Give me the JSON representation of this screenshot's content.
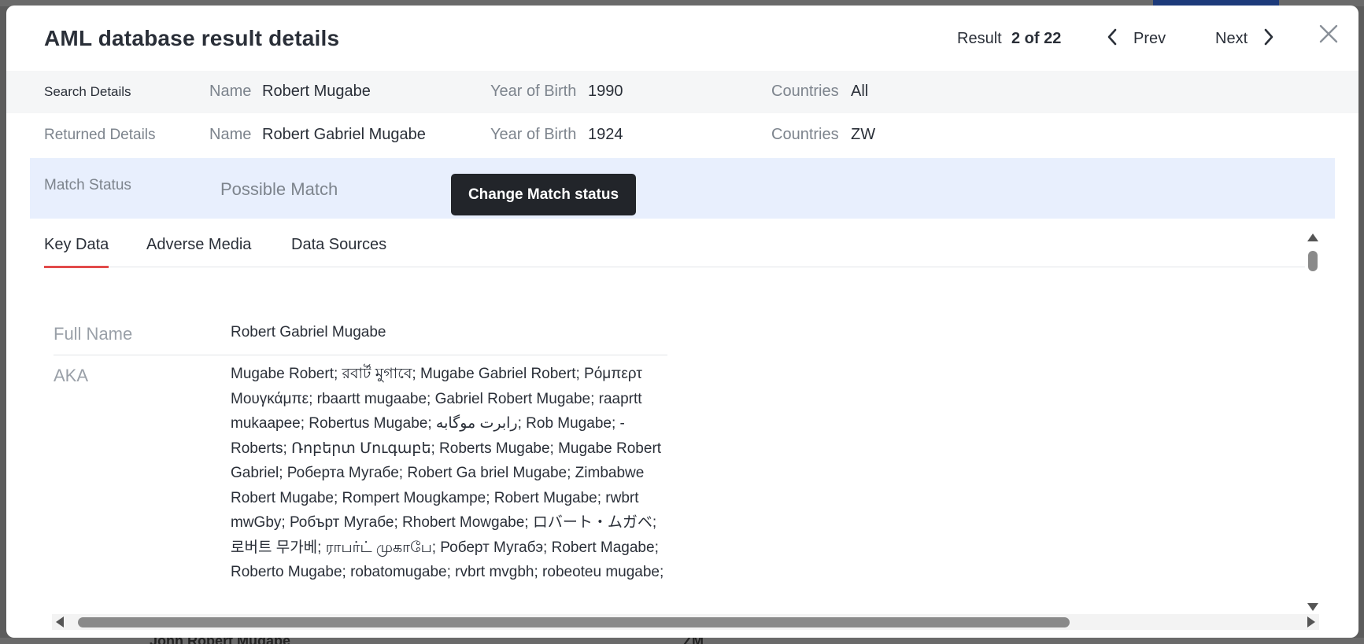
{
  "modal": {
    "title": "AML database result details",
    "result_label": "Result",
    "result_count": "2 of 22",
    "prev_label": "Prev",
    "next_label": "Next"
  },
  "search_details": {
    "row_label": "Search Details",
    "name_label": "Name",
    "name_value": "Robert Mugabe",
    "yob_label": "Year of Birth",
    "yob_value": "1990",
    "countries_label": "Countries",
    "countries_value": "All"
  },
  "returned_details": {
    "row_label": "Returned Details",
    "name_label": "Name",
    "name_value": "Robert Gabriel Mugabe",
    "yob_label": "Year of Birth",
    "yob_value": "1924",
    "countries_label": "Countries",
    "countries_value": "ZW"
  },
  "match_status": {
    "row_label": "Match Status",
    "value": "Possible Match",
    "change_button": "Change Match status"
  },
  "tabs": [
    {
      "label": "Key Data",
      "active": true
    },
    {
      "label": "Adverse Media",
      "active": false
    },
    {
      "label": "Data Sources",
      "active": false
    }
  ],
  "key_data": {
    "full_name_label": "Full Name",
    "full_name_value": "Robert Gabriel Mugabe",
    "aka_label": "AKA",
    "aka_value": "Mugabe Robert; রবার্ট মুগাবে; Mugabe Gabriel Robert; Ρόμπερτ Μουγκάμπε; rbaartt mugaabe; Gabriel Robert Mugabe; raaprtt mukaapee; Robertus Mugabe; رابرت موگابه; Rob Mugabe; -Roberts; Ռոբերտ Մուգաբե; Roberts Mugabe; Mugabe Robert Gabriel; Роберта Мугабе; Robert Ga briel Mugabe; Zimbabwe Robert Mugabe; Rompert Mougkampe; Robert Mugabe; rwbrt mwGby; Робърт Мугабе; Rhobert Mowgabe; ロバート・ムガベ; 로버트 무가베; ராபர்ட் முகாபே; Роберт Мугабэ; Robert Magabe; Roberto Mugabe; robatomugabe; rvbrt mvgbh; robeoteu mugabe;"
  },
  "backdrop": {
    "row_name": "John Robert Mugabe",
    "row_country": "ZM"
  },
  "colors": {
    "accent_tab": "#e24b4b",
    "match_row_bg": "#e8effd",
    "button_dark": "#22252a"
  }
}
